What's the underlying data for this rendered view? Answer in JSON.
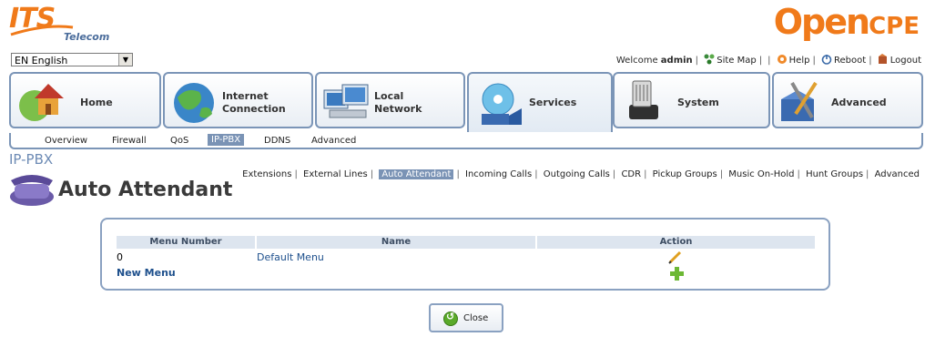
{
  "brand": {
    "its_main": "ITS",
    "its_sub": "Telecom",
    "opencpe_a": "Open",
    "opencpe_b": "CPE"
  },
  "language": {
    "selected": "EN English"
  },
  "toplinks": {
    "welcome": "Welcome",
    "user": "admin",
    "sitemap": "Site Map",
    "help": "Help",
    "reboot": "Reboot",
    "logout": "Logout"
  },
  "tabs": [
    {
      "label_line1": "Home",
      "label_line2": ""
    },
    {
      "label_line1": "Internet",
      "label_line2": "Connection"
    },
    {
      "label_line1": "Local",
      "label_line2": "Network"
    },
    {
      "label_line1": "Services",
      "label_line2": ""
    },
    {
      "label_line1": "System",
      "label_line2": ""
    },
    {
      "label_line1": "Advanced",
      "label_line2": ""
    }
  ],
  "subnav": [
    "Overview",
    "Firewall",
    "QoS",
    "IP-PBX",
    "DDNS",
    "Advanced"
  ],
  "section_title": "IP-PBX",
  "pbx_links": [
    "Extensions",
    "External Lines",
    "Auto Attendant",
    "Incoming Calls",
    "Outgoing Calls",
    "CDR",
    "Pickup Groups",
    "Music On-Hold",
    "Hunt Groups",
    "Advanced"
  ],
  "page_title": "Auto Attendant",
  "table": {
    "headers": [
      "Menu Number",
      "Name",
      "Action"
    ],
    "rows": [
      {
        "number": "0",
        "name": "Default Menu"
      }
    ],
    "new_label": "New Menu"
  },
  "close_label": "Close",
  "colors": {
    "accent": "#7a93b5",
    "border": "#7b95b7",
    "orange": "#f07a1a",
    "link": "#1d4f8c"
  }
}
